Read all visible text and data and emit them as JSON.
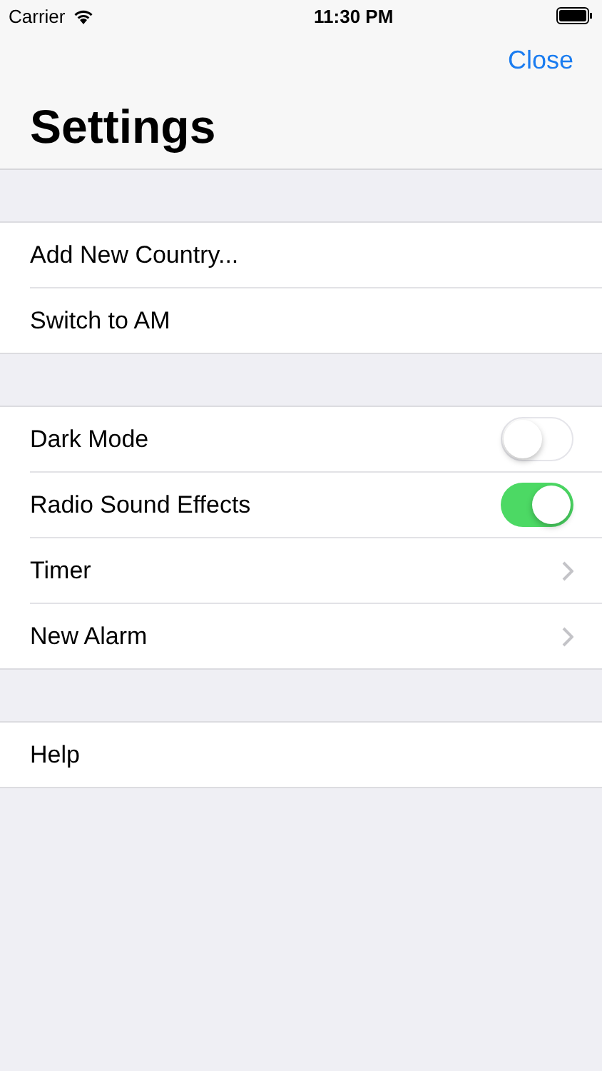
{
  "status_bar": {
    "carrier": "Carrier",
    "time": "11:30 PM"
  },
  "nav": {
    "action": "Close",
    "title": "Settings"
  },
  "sections": [
    {
      "rows": [
        {
          "kind": "plain",
          "label": "Add New Country..."
        },
        {
          "kind": "plain",
          "label": "Switch to AM"
        }
      ]
    },
    {
      "rows": [
        {
          "kind": "toggle",
          "label": "Dark Mode",
          "on": false
        },
        {
          "kind": "toggle",
          "label": "Radio Sound Effects",
          "on": true
        },
        {
          "kind": "disclosure",
          "label": "Timer"
        },
        {
          "kind": "disclosure",
          "label": "New Alarm"
        }
      ]
    },
    {
      "rows": [
        {
          "kind": "plain",
          "label": "Help"
        }
      ]
    }
  ]
}
